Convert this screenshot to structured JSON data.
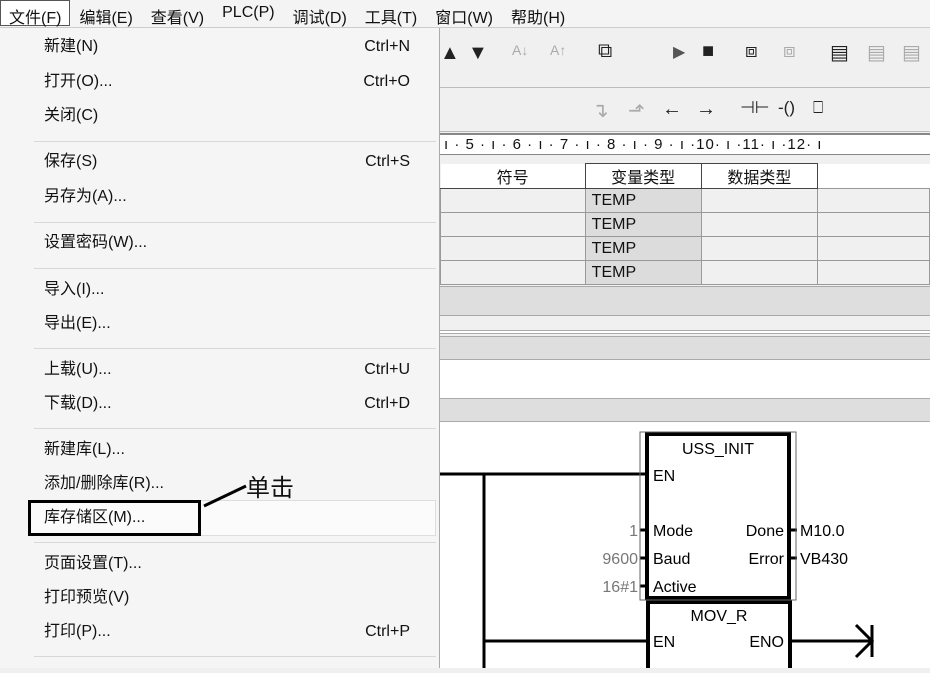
{
  "menubar": [
    "文件(F)",
    "编辑(E)",
    "查看(V)",
    "PLC(P)",
    "调试(D)",
    "工具(T)",
    "窗口(W)",
    "帮助(H)"
  ],
  "file_menu": [
    {
      "label": "新建(N)",
      "shortcut": "Ctrl+N"
    },
    {
      "label": "打开(O)...",
      "shortcut": "Ctrl+O"
    },
    {
      "label": "关闭(C)",
      "shortcut": ""
    },
    {
      "label": "保存(S)",
      "shortcut": "Ctrl+S"
    },
    {
      "label": "另存为(A)...",
      "shortcut": ""
    },
    {
      "label": "设置密码(W)...",
      "shortcut": ""
    },
    {
      "label": "导入(I)...",
      "shortcut": ""
    },
    {
      "label": "导出(E)...",
      "shortcut": ""
    },
    {
      "label": "上载(U)...",
      "shortcut": "Ctrl+U"
    },
    {
      "label": "下载(D)...",
      "shortcut": "Ctrl+D"
    },
    {
      "label": "新建库(L)...",
      "shortcut": ""
    },
    {
      "label": "添加/删除库(R)...",
      "shortcut": ""
    },
    {
      "label": "库存储区(M)...",
      "shortcut": ""
    },
    {
      "label": "页面设置(T)...",
      "shortcut": ""
    },
    {
      "label": "打印预览(V)",
      "shortcut": ""
    },
    {
      "label": "打印(P)...",
      "shortcut": "Ctrl+P"
    }
  ],
  "annotation": "单击",
  "ruler": "ı · 5 · ı · 6 · ı · 7 · ı · 8 · ı · 9 · ı ·10· ı ·11· ı ·12· ı",
  "table": {
    "headers": [
      "符号",
      "变量类型",
      "数据类型"
    ],
    "rows": [
      [
        "",
        "TEMP",
        ""
      ],
      [
        "",
        "TEMP",
        ""
      ],
      [
        "",
        "TEMP",
        ""
      ],
      [
        "",
        "TEMP",
        ""
      ]
    ]
  },
  "ladder": {
    "uss_init": {
      "title": "USS_INIT",
      "en": "EN",
      "inputs": [
        {
          "pin": "Mode",
          "value": "1"
        },
        {
          "pin": "Baud",
          "value": "9600"
        },
        {
          "pin": "Active",
          "value": "16#1"
        }
      ],
      "outputs": [
        {
          "pin": "Done",
          "value": "M10.0"
        },
        {
          "pin": "Error",
          "value": "VB430"
        }
      ]
    },
    "mov_r": {
      "title": "MOV_R",
      "en": "EN",
      "eno": "ENO"
    }
  }
}
